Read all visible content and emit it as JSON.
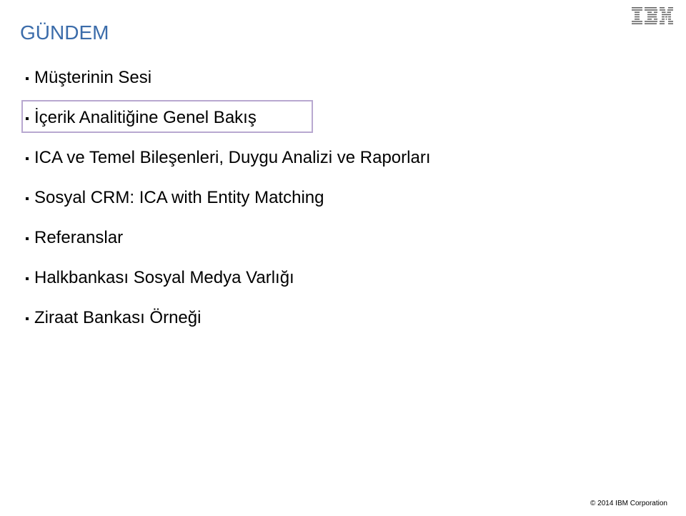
{
  "slide": {
    "title": "GÜNDEM",
    "items": [
      "Müşterinin Sesi",
      "İçerik Analitiğine Genel Bakış",
      "ICA ve Temel Bileşenleri, Duygu Analizi ve Raporları",
      "Sosyal CRM: ICA with Entity Matching",
      "Referanslar",
      "Halkbankası Sosyal Medya Varlığı",
      "Ziraat Bankası Örneği"
    ],
    "footer": "© 2014 IBM Corporation",
    "logo_name": "IBM"
  }
}
